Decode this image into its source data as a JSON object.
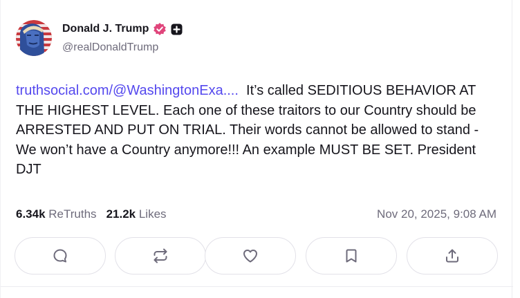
{
  "author": {
    "name": "Donald J. Trump",
    "handle": "@realDonaldTrump"
  },
  "post": {
    "link_text": "truthsocial.com/@WashingtonExa....",
    "body_line_1": "  It’s called SEDITIOUS",
    "body_rest": "BEHAVIOR AT THE HIGHEST LEVEL. Each one of these traitors to our Country should be ARRESTED AND PUT ON TRIAL. Their words cannot be allowed to stand - We won’t have a Country anymore!!! An example MUST BE SET. President DJT"
  },
  "stats": {
    "retruths_count": "6.34k",
    "retruths_label": "ReTruths",
    "likes_count": "21.2k",
    "likes_label": "Likes",
    "timestamp": "Nov 20, 2025, 9:08 AM"
  },
  "actions": [
    {
      "icon": "reply-icon"
    },
    {
      "icon": "retruth-icon"
    },
    {
      "icon": "like-icon"
    },
    {
      "icon": "bookmark-icon"
    },
    {
      "icon": "share-icon"
    }
  ],
  "colors": {
    "link": "#5448ee",
    "verified_badge": "#e0457b",
    "text_primary": "#16151c",
    "text_secondary": "#6e6b7b",
    "button_border": "#e2e1e8"
  }
}
